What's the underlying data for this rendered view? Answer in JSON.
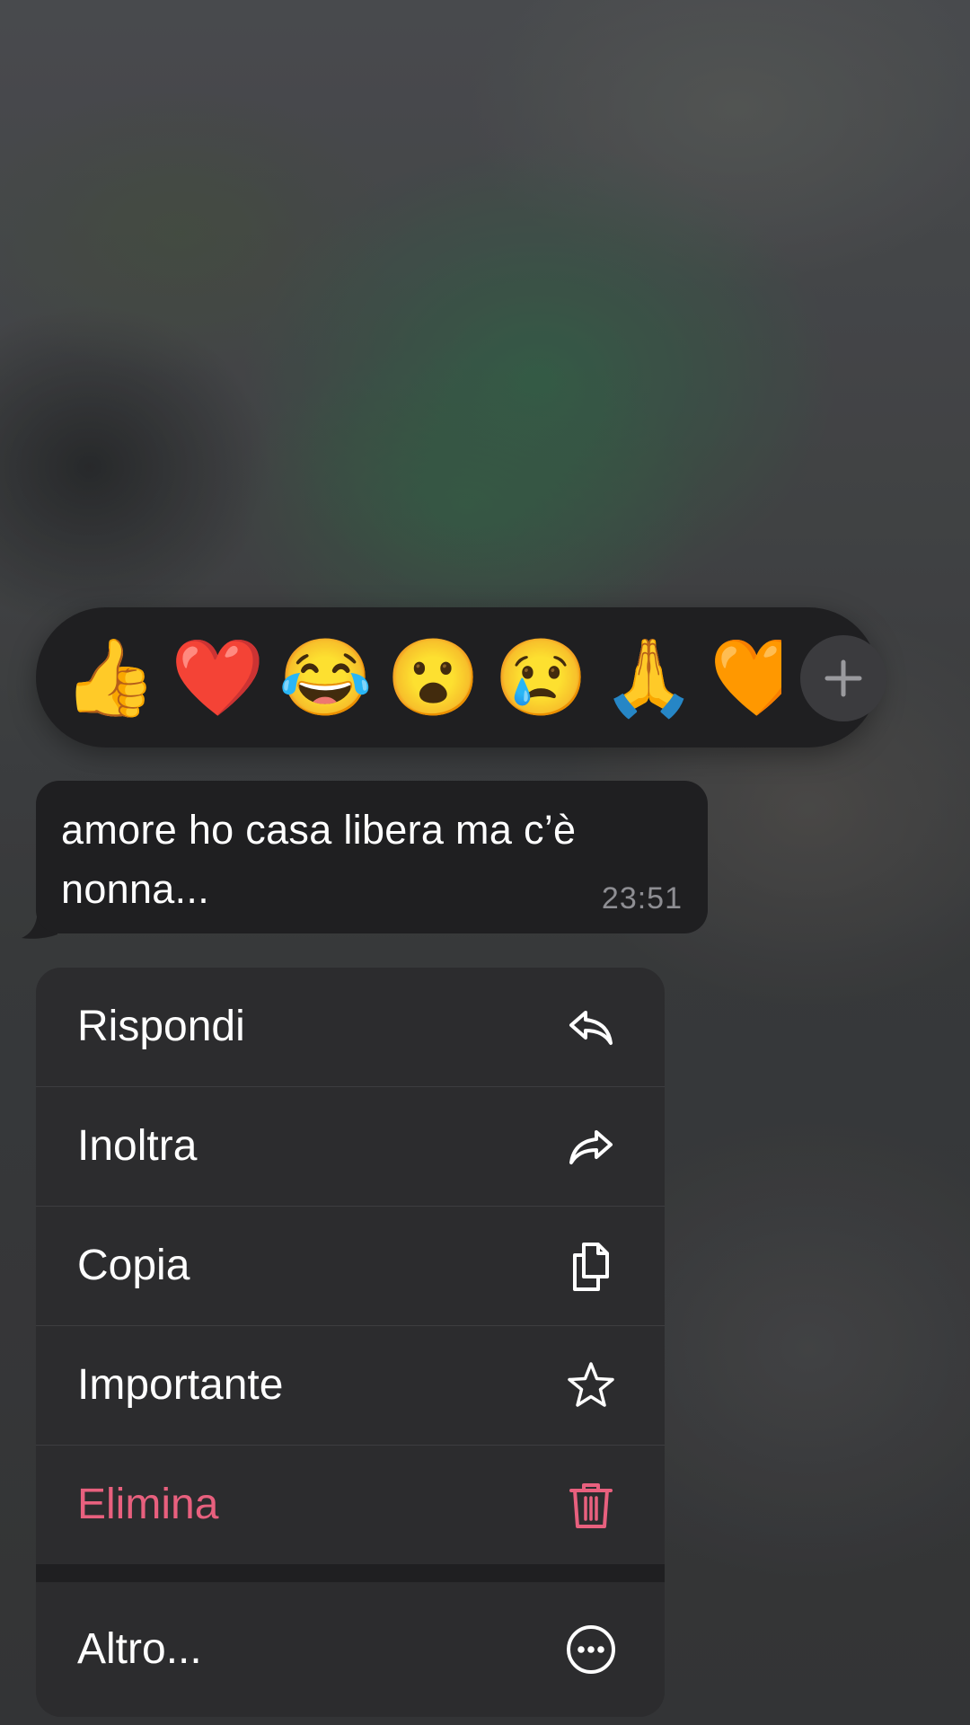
{
  "reactions": {
    "emojis": [
      "👍",
      "❤️",
      "😂",
      "😮",
      "😢",
      "🙏",
      "🧡"
    ],
    "add_icon": "plus-icon"
  },
  "message": {
    "text": "amore ho casa libera ma c’è nonna...",
    "time": "23:51"
  },
  "menu": {
    "items": [
      {
        "label": "Rispondi",
        "icon": "reply-icon"
      },
      {
        "label": "Inoltra",
        "icon": "forward-icon"
      },
      {
        "label": "Copia",
        "icon": "copy-icon"
      },
      {
        "label": "Importante",
        "icon": "star-icon"
      },
      {
        "label": "Elimina",
        "icon": "trash-icon",
        "color": "#e8607e"
      }
    ],
    "more": {
      "label": "Altro...",
      "icon": "more-icon"
    }
  },
  "colors": {
    "danger": "#e8607e",
    "surface": "#1f1f21",
    "menu_bg": "#2c2c2e"
  }
}
